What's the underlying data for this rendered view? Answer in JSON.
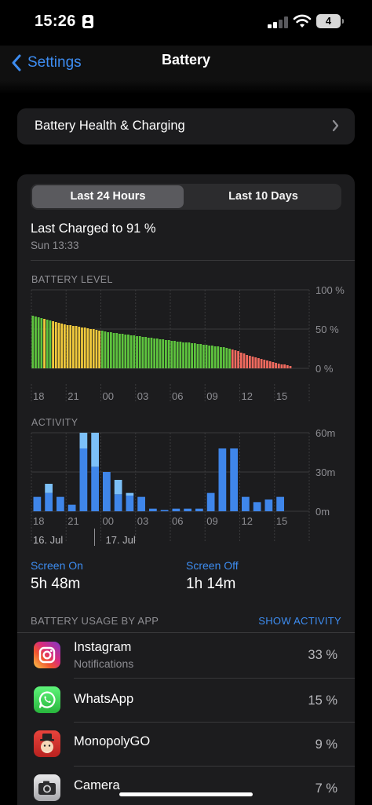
{
  "status_bar": {
    "time": "15:26",
    "battery_level": "4"
  },
  "nav": {
    "back_label": "Settings",
    "title": "Battery"
  },
  "health_row": {
    "label": "Battery Health & Charging"
  },
  "segmented": {
    "options": [
      "Last 24 Hours",
      "Last 10 Days"
    ],
    "selected": "Last 24 Hours"
  },
  "last_charged": {
    "text": "Last Charged to 91 %",
    "time": "Sun 13:33"
  },
  "battery_section_label": "BATTERY LEVEL",
  "activity_section_label": "ACTIVITY",
  "screen_on": {
    "label": "Screen On",
    "value": "5h 48m"
  },
  "screen_off": {
    "label": "Screen Off",
    "value": "1h 14m"
  },
  "usage": {
    "label": "BATTERY USAGE BY APP",
    "action": "SHOW ACTIVITY"
  },
  "apps": [
    {
      "name": "Instagram",
      "sub": "Notifications",
      "pct": "33 %",
      "icon": "instagram-icon"
    },
    {
      "name": "WhatsApp",
      "sub": "",
      "pct": "15 %",
      "icon": "whatsapp-icon"
    },
    {
      "name": "MonopolyGO",
      "sub": "",
      "pct": "9 %",
      "icon": "monopoly-go-icon"
    },
    {
      "name": "Camera",
      "sub": "",
      "pct": "7 %",
      "icon": "camera-icon"
    }
  ],
  "colors": {
    "accent": "#3d8cf0",
    "battery_green": "#5ec43e",
    "battery_yellow": "#f0c93c",
    "battery_red": "#f06a5e",
    "activity_dark": "#3f86ea",
    "activity_light": "#7cc0f8"
  },
  "chart_data": [
    {
      "type": "bar",
      "title": "BATTERY LEVEL",
      "unit": "%",
      "ylim": [
        0,
        100
      ],
      "y_ticks": [
        "100 %",
        "50 %",
        "0 %"
      ],
      "x_ticks": [
        "18",
        "21",
        "00",
        "03",
        "06",
        "09",
        "12",
        "15"
      ],
      "note": "x ticks every 3 hours starting 18:00 on 16 Jul; bars every 15 minutes; color = state (green normal, yellow low-power mode, red low battery)",
      "values": [
        67,
        66,
        65,
        64,
        63,
        62,
        61,
        60,
        59,
        58,
        57,
        56,
        55,
        55,
        54,
        54,
        53,
        52,
        52,
        51,
        50,
        50,
        49,
        48,
        48,
        47,
        46,
        46,
        45,
        45,
        44,
        44,
        43,
        43,
        42,
        42,
        41,
        41,
        40,
        40,
        39,
        39,
        38,
        38,
        37,
        37,
        36,
        36,
        35,
        35,
        34,
        34,
        33,
        33,
        33,
        32,
        32,
        31,
        31,
        30,
        30,
        29,
        29,
        28,
        28,
        27,
        27,
        26,
        25,
        24,
        23,
        22,
        20,
        19,
        17,
        16,
        15,
        14,
        13,
        12,
        11,
        10,
        9,
        8,
        7,
        6,
        5,
        5,
        4,
        3
      ],
      "states": [
        "g",
        "g",
        "g",
        "g",
        "y",
        "g",
        "g",
        "y",
        "y",
        "y",
        "y",
        "y",
        "y",
        "y",
        "y",
        "y",
        "y",
        "y",
        "y",
        "y",
        "y",
        "y",
        "y",
        "y",
        "g",
        "g",
        "g",
        "g",
        "g",
        "g",
        "g",
        "g",
        "g",
        "g",
        "g",
        "g",
        "g",
        "g",
        "g",
        "g",
        "g",
        "g",
        "g",
        "g",
        "g",
        "g",
        "g",
        "g",
        "g",
        "g",
        "g",
        "g",
        "g",
        "g",
        "g",
        "g",
        "g",
        "g",
        "g",
        "g",
        "g",
        "g",
        "g",
        "g",
        "g",
        "g",
        "g",
        "g",
        "g",
        "r",
        "r",
        "r",
        "r",
        "r",
        "r",
        "r",
        "r",
        "r",
        "r",
        "r",
        "r",
        "r",
        "r",
        "r",
        "r",
        "r",
        "r",
        "r",
        "r",
        "r"
      ]
    },
    {
      "type": "bar",
      "title": "ACTIVITY",
      "unit": "minutes",
      "ylim": [
        0,
        60
      ],
      "y_ticks": [
        "60m",
        "30m",
        "0m"
      ],
      "x_ticks": [
        "18",
        "21",
        "00",
        "03",
        "06",
        "09",
        "12",
        "15"
      ],
      "date_labels": [
        "16. Jul",
        "17. Jul"
      ],
      "series": [
        {
          "name": "Screen On",
          "values": [
            11,
            14,
            11,
            5,
            48,
            34,
            30,
            13,
            12,
            11,
            2,
            1,
            2,
            2,
            2,
            14,
            48,
            48,
            11,
            7,
            9,
            11
          ]
        },
        {
          "name": "Screen Off",
          "values": [
            0,
            7,
            0,
            0,
            12,
            26,
            0,
            11,
            2,
            0,
            0,
            0,
            0,
            0,
            0,
            0,
            0,
            0,
            0,
            0,
            0,
            0
          ]
        }
      ]
    }
  ]
}
